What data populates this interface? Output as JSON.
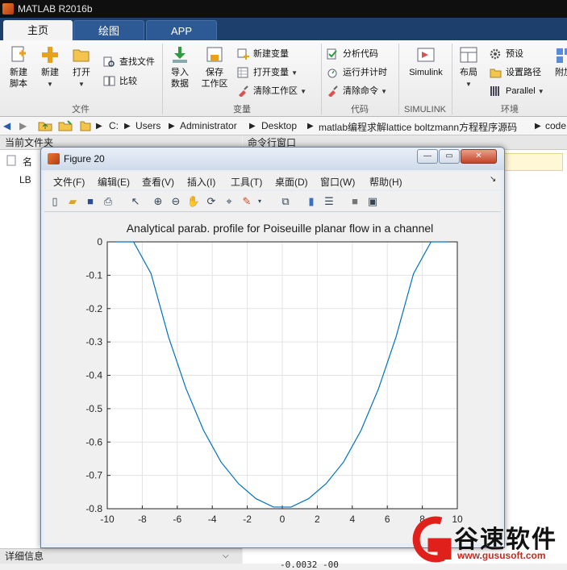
{
  "window": {
    "title": "MATLAB R2016b"
  },
  "tabs": [
    {
      "label": "主页"
    },
    {
      "label": "绘图"
    },
    {
      "label": "APP"
    }
  ],
  "ribbon": {
    "new_script": "新建\n脚本",
    "new": "新建",
    "open": "打开",
    "find_files": "查找文件",
    "compare": "比较",
    "import": "导入\n数据",
    "save_ws": "保存\n工作区",
    "new_var": "新建变量",
    "open_var": "打开变量",
    "clear_ws": "清除工作区",
    "analyze": "分析代码",
    "run_time": "运行并计时",
    "clear_cmd": "清除命令",
    "simulink": "Simulink",
    "layout": "布局",
    "prefs": "预设",
    "set_path": "设置路径",
    "parallel": "Parallel",
    "addons": "附加",
    "groups": {
      "file": "文件",
      "variable": "变量",
      "code": "代码",
      "simulink": "SIMULINK",
      "env": "环境"
    }
  },
  "address": {
    "crumbs": [
      "C:",
      "Users",
      "Administrator",
      "Desktop",
      "matlab编程求解lattice boltzmann方程程序源码",
      "code"
    ]
  },
  "panels": {
    "current_folder": "当前文件夹",
    "command_window": "命令行窗口",
    "details": "详细信息",
    "row1": "名",
    "row2": "LB",
    "cmd_tail": "-0.0032  -00"
  },
  "figure": {
    "title": "Figure 20",
    "menu": [
      "文件(F)",
      "编辑(E)",
      "查看(V)",
      "插入(I)",
      "工具(T)",
      "桌面(D)",
      "窗口(W)",
      "帮助(H)"
    ]
  },
  "watermark": {
    "brand": "谷速软件",
    "url": "www.gususoft.com"
  },
  "chart_data": {
    "type": "line",
    "title": "Analytical parab. profile for Poiseuille planar flow in a channel",
    "xlabel": "",
    "ylabel": "",
    "xlim": [
      -10,
      10
    ],
    "ylim": [
      -0.8,
      0
    ],
    "xticks": [
      -10,
      -8,
      -6,
      -4,
      -2,
      0,
      2,
      4,
      6,
      8,
      10
    ],
    "yticks": [
      0,
      -0.1,
      -0.2,
      -0.3,
      -0.4,
      -0.5,
      -0.6,
      -0.7,
      -0.8
    ],
    "grid": true,
    "series": [
      {
        "color": "#0072bd",
        "x": [
          -9.5,
          -8.5,
          -7.5,
          -6.5,
          -5.5,
          -4.5,
          -3.5,
          -2.5,
          -1.5,
          -0.5,
          0.5,
          1.5,
          2.5,
          3.5,
          4.5,
          5.5,
          6.5,
          7.5,
          8.5,
          9.5
        ],
        "y": [
          0,
          0,
          -0.095,
          -0.285,
          -0.44,
          -0.565,
          -0.66,
          -0.725,
          -0.77,
          -0.795,
          -0.795,
          -0.77,
          -0.725,
          -0.66,
          -0.565,
          -0.44,
          -0.285,
          -0.095,
          0,
          0
        ]
      }
    ]
  }
}
